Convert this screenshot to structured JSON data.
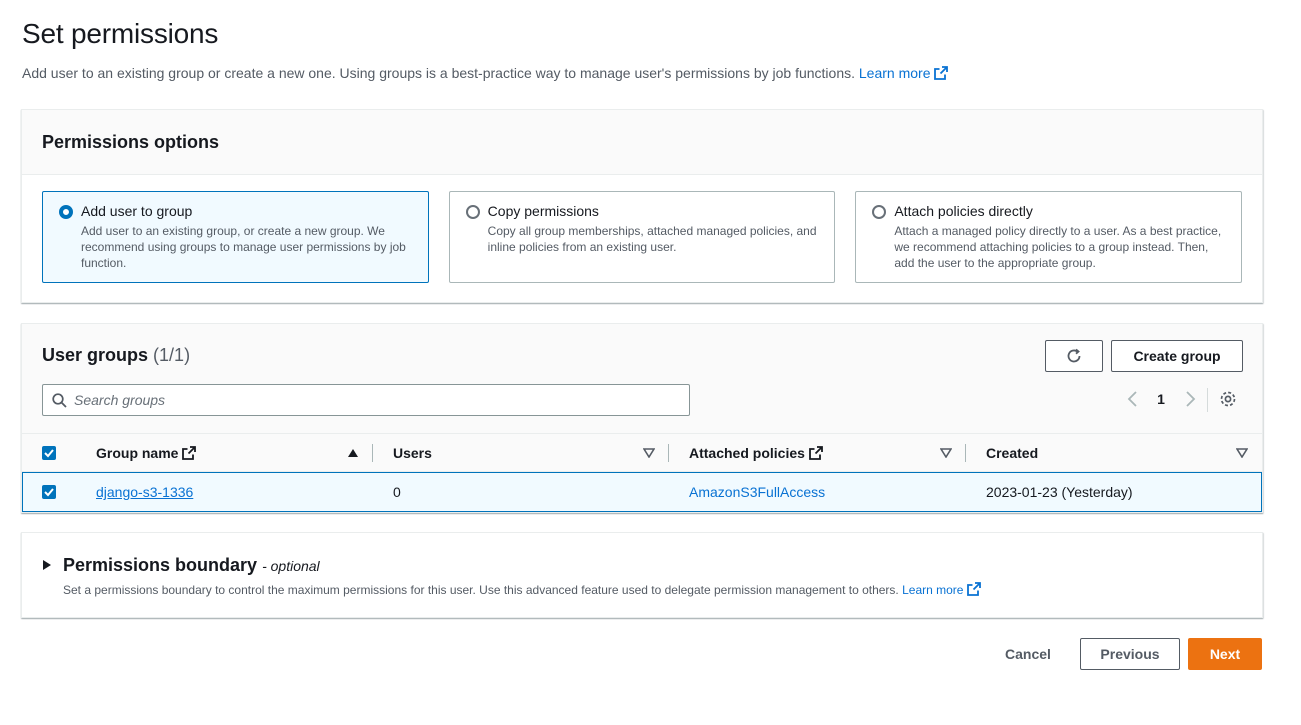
{
  "page": {
    "title": "Set permissions",
    "description": "Add user to an existing group or create a new one. Using groups is a best-practice way to manage user's permissions by job functions.",
    "learn_more": "Learn more"
  },
  "permissions_options": {
    "title": "Permissions options",
    "options": [
      {
        "label": "Add user to group",
        "description": "Add user to an existing group, or create a new group. We recommend using groups to manage user permissions by job function.",
        "selected": true
      },
      {
        "label": "Copy permissions",
        "description": "Copy all group memberships, attached managed policies, and inline policies from an existing user.",
        "selected": false
      },
      {
        "label": "Attach policies directly",
        "description": "Attach a managed policy directly to a user. As a best practice, we recommend attaching policies to a group instead. Then, add the user to the appropriate group.",
        "selected": false
      }
    ]
  },
  "user_groups": {
    "title": "User groups",
    "count": "(1/1)",
    "create_group_label": "Create group",
    "search_placeholder": "Search groups",
    "search_value": "",
    "page_number": "1",
    "columns": {
      "group_name": "Group name",
      "users": "Users",
      "attached_policies": "Attached policies",
      "created": "Created"
    },
    "rows": [
      {
        "group_name": "django-s3-1336",
        "users": "0",
        "attached_policies": "AmazonS3FullAccess",
        "created": "2023-01-23 (Yesterday)",
        "selected": true
      }
    ]
  },
  "permissions_boundary": {
    "title": "Permissions boundary",
    "optional": "- optional",
    "description": "Set a permissions boundary to control the maximum permissions for this user. Use this advanced feature used to delegate permission management to others.",
    "learn_more": "Learn more"
  },
  "footer": {
    "cancel_label": "Cancel",
    "previous_label": "Previous",
    "next_label": "Next"
  },
  "colors": {
    "accent": "#0073bb",
    "link": "#0972d3",
    "primary_button": "#ec7211"
  },
  "icons": [
    "external-link-icon",
    "search-icon",
    "refresh-icon",
    "chevron-left-icon",
    "chevron-right-icon",
    "settings-icon",
    "sort-ascending-icon",
    "sort-icon",
    "checkbox-checked-icon",
    "caret-right-icon"
  ]
}
